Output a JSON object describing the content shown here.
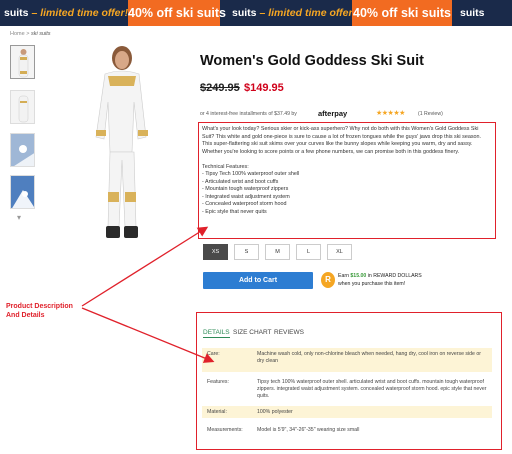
{
  "banner": {
    "brand": "suits",
    "tagline": "– limited time offer!",
    "offer": "40% off ski suits"
  },
  "breadcrumb": {
    "home": "Home",
    "separator": ">",
    "current": "ski suits"
  },
  "product": {
    "title": "Women's Gold Goddess Ski Suit",
    "price_original": "$249.95",
    "price_sale": "$149.95",
    "installments_text": "or 4 interest-free installments of $37.49 by",
    "afterpay_logo": "afterpay",
    "rating_stars": "★★★★★",
    "review_count": "(1 Review)"
  },
  "description": {
    "paragraph": "What's your look today? Serious skier or kick-ass superhero? Why not do both with this Women's Gold Goddess Ski Suit? This white and gold one-piece is sure to cause a lot of frozen tongues while the guys' jaws drop this ski season. This super-flattering ski suit skims over your curves like the bunny slopes while keeping you warm, dry and sassy. Whether you're looking to score points or a few phone numbers, we can promise both in this goddess finery.",
    "features_heading": "Technical Features:",
    "features": [
      "- Tipsy Tech 100% waterproof outer shell",
      "- Articulated wrist and boot cuffs",
      "- Mountain tough waterproof zippers",
      "- Integrated waist adjustment system",
      "- Concealed waterproof storm hood",
      "- Epic style that never quits"
    ]
  },
  "sizes": {
    "options": [
      "XS",
      "S",
      "M",
      "L",
      "XL"
    ],
    "selected": "XS"
  },
  "cart": {
    "label": "Add to Cart"
  },
  "reward": {
    "icon_letter": "R",
    "line1_prefix": "Earn",
    "amount": "$15.00",
    "line1_suffix": "in REWARD DOLLARS",
    "line2": "when you purchase this item!"
  },
  "tabs": [
    "DETAILS",
    "SIZE CHART",
    "REVIEWS"
  ],
  "details": [
    {
      "label": "Care:",
      "value": "Machine wash cold, only non-chlorine bleach when needed, hang dry, cool iron on reverse side or dry clean"
    },
    {
      "label": "Features:",
      "value": "Tipsy tech 100% waterproof outer shell. articulated wrist and boot cuffs. mountain tough waterproof zippers. integrated waist adjustment system. concealed waterproof storm hood. epic style that never quits."
    },
    {
      "label": "Material:",
      "value": "100% polyester"
    },
    {
      "label": "Measurements:",
      "value": "Model is 5'9\", 34\"-26\"-35\" wearing size small"
    }
  ],
  "annotation": {
    "line1": "Product Description",
    "line2": "And Details"
  },
  "colors": {
    "banner_bg": "#1a2a4a",
    "banner_orange": "#f26b21",
    "sale_red": "#d0021b",
    "cart_blue": "#2d7dd2",
    "annotation_red": "#e0212b",
    "tab_green": "#2e8b57"
  }
}
